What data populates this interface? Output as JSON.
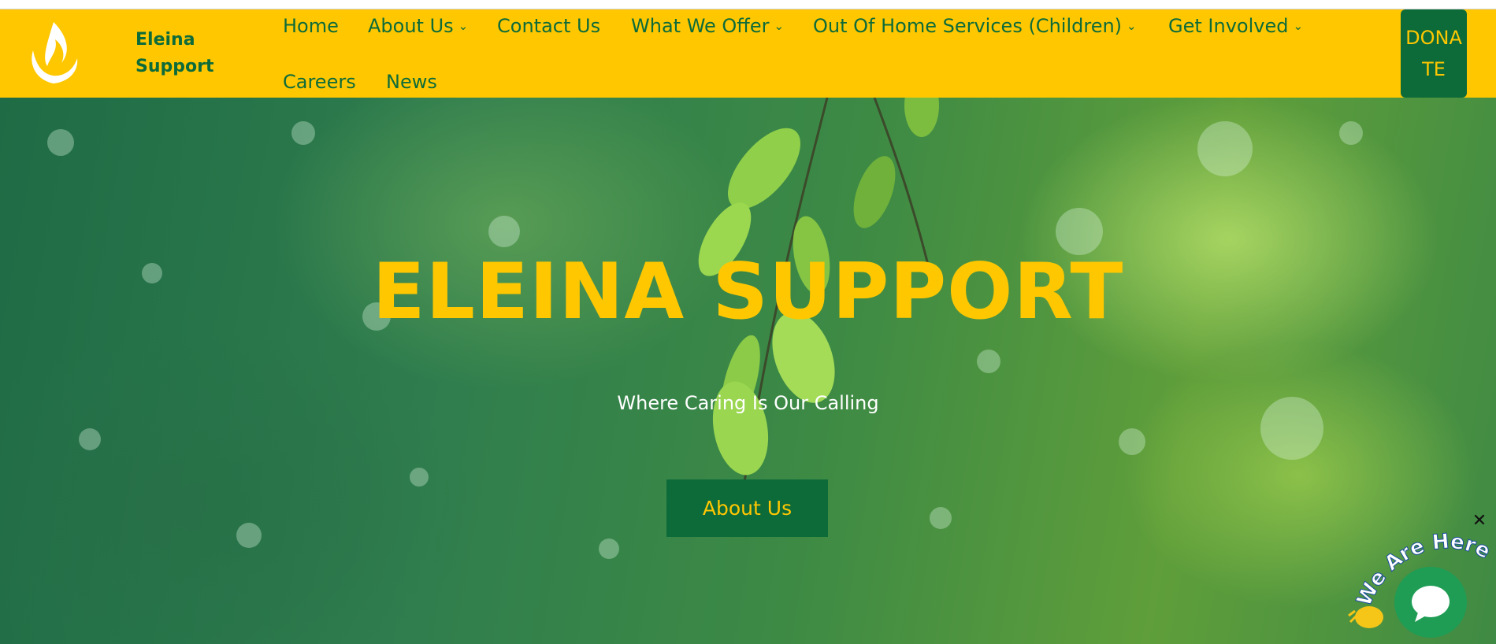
{
  "brand": {
    "name_line1": "Eleina",
    "name_line2": "Support"
  },
  "nav": {
    "home": "Home",
    "about": "About Us",
    "contact": "Contact Us",
    "offer": "What We Offer",
    "ooh": "Out Of Home Services (Children)",
    "involved": "Get Involved",
    "careers": "Careers",
    "news": "News",
    "chevron": "⌄"
  },
  "donate": {
    "label": "DONATE"
  },
  "hero": {
    "title": "ELEINA SUPPORT",
    "subtitle": "Where Caring Is Our Calling",
    "button": "About Us"
  },
  "chat": {
    "tagline": "We Are Here!",
    "close": "✕"
  },
  "colors": {
    "header_bg": "#ffc700",
    "brand_green": "#0d6b3a",
    "accent_yellow": "#ffc700",
    "chat_green": "#1f9d55"
  },
  "icons": {
    "logo": "flame-logo-icon",
    "chat": "chat-bubble-icon",
    "wave": "waving-hand-icon",
    "close": "close-icon"
  }
}
